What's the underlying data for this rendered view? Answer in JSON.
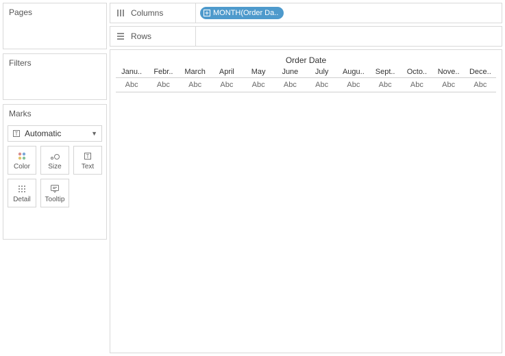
{
  "panels": {
    "pages": "Pages",
    "filters": "Filters",
    "marks": "Marks"
  },
  "marks": {
    "dropdown": "Automatic",
    "buttons": {
      "color": "Color",
      "size": "Size",
      "text": "Text",
      "detail": "Detail",
      "tooltip": "Tooltip"
    }
  },
  "shelves": {
    "columns": "Columns",
    "rows": "Rows",
    "pill": "MONTH(Order Da.."
  },
  "viz": {
    "title": "Order Date",
    "months": [
      "Janu..",
      "Febr..",
      "March",
      "April",
      "May",
      "June",
      "July",
      "Augu..",
      "Sept..",
      "Octo..",
      "Nove..",
      "Dece.."
    ],
    "placeholder": "Abc"
  }
}
